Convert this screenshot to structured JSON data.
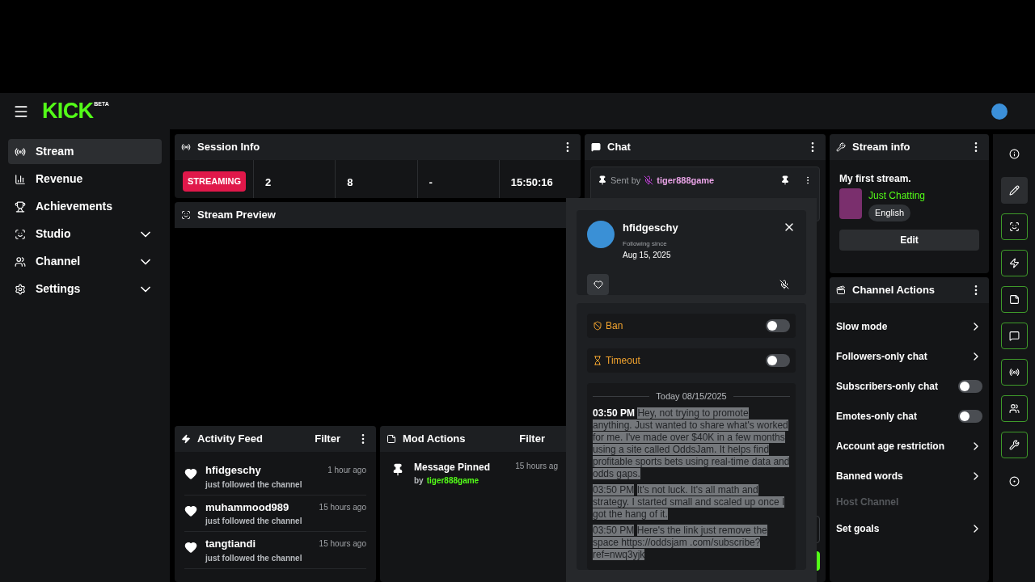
{
  "header": {
    "logo": "KICK",
    "logo_badge": "BETA"
  },
  "sidebar": {
    "items": [
      {
        "label": "Stream",
        "selected": true,
        "expandable": false
      },
      {
        "label": "Revenue",
        "selected": false,
        "expandable": false
      },
      {
        "label": "Achievements",
        "selected": false,
        "expandable": false
      },
      {
        "label": "Studio",
        "selected": false,
        "expandable": true
      },
      {
        "label": "Channel",
        "selected": false,
        "expandable": true
      },
      {
        "label": "Settings",
        "selected": false,
        "expandable": true
      }
    ]
  },
  "session_info": {
    "title": "Session Info",
    "status": "STREAMING",
    "stats": [
      "2",
      "8",
      "-",
      "15:50:16"
    ]
  },
  "stream_preview": {
    "title": "Stream Preview"
  },
  "activity_feed": {
    "title": "Activity Feed",
    "filter": "Filter",
    "events": [
      {
        "user": "hfidgeschy",
        "action": "just followed the channel",
        "time": "1 hour ago"
      },
      {
        "user": "muhammood989",
        "action": "just followed the channel",
        "time": "15 hours ago"
      },
      {
        "user": "tangtiandi",
        "action": "just followed the channel",
        "time": "15 hours ago"
      }
    ]
  },
  "mod_actions": {
    "title": "Mod Actions",
    "filter": "Filter",
    "events": [
      {
        "action": "Message Pinned",
        "by": "by",
        "user": "tiger888game",
        "time": "15 hours ag"
      }
    ]
  },
  "chat": {
    "title": "Chat",
    "pinned": {
      "sent_by": "Sent by",
      "user": "tiger888game"
    }
  },
  "user_card": {
    "username": "hfidgeschy",
    "following_label": "Following since",
    "following_date": "Aug 15, 2025",
    "moderation": [
      {
        "label": "Ban",
        "kind": "ban",
        "on": false
      },
      {
        "label": "Timeout",
        "kind": "timeout",
        "on": false
      }
    ],
    "date_divider": "Today 08/15/2025",
    "messages": [
      {
        "time": "03:50 PM",
        "text": "Hey, not trying to promote anything. Just wanted to share what's worked for me. I've made over $40K in a few months using a site called OddsJam. It helps find profitable sports bets using real-time data and odds gaps.",
        "highlighted": true,
        "time_highlighted": false
      },
      {
        "time": "03:50 PM",
        "text": "It's not luck. It's all math and strategy. I started small and scaled up once I got the hang of it.",
        "highlighted": true,
        "time_highlighted": true
      },
      {
        "time": "03:50 PM",
        "text": "Here's the link just remove the space https://oddsjam .com/subscribe?ref=nwq3yjk",
        "highlighted": true,
        "time_highlighted": true
      }
    ]
  },
  "stream_info": {
    "title": "Stream info",
    "stream_title": "My first stream.",
    "category": "Just Chatting",
    "language": "English",
    "edit": "Edit"
  },
  "channel_actions": {
    "title": "Channel Actions",
    "items": [
      {
        "label": "Slow mode",
        "kind": "link"
      },
      {
        "label": "Followers-only chat",
        "kind": "link"
      },
      {
        "label": "Subscribers-only chat",
        "kind": "toggle",
        "on": false
      },
      {
        "label": "Emotes-only chat",
        "kind": "toggle",
        "on": false
      },
      {
        "label": "Account age restriction",
        "kind": "link"
      },
      {
        "label": "Banned words",
        "kind": "link"
      },
      {
        "label": "Host Channel",
        "kind": "disabled"
      },
      {
        "label": "Set goals",
        "kind": "link"
      }
    ]
  },
  "rail": [
    {
      "kind": "plain"
    },
    {
      "kind": "active"
    },
    {
      "kind": "outlined"
    },
    {
      "kind": "outlined"
    },
    {
      "kind": "outlined"
    },
    {
      "kind": "outlined"
    },
    {
      "kind": "outlined"
    },
    {
      "kind": "outlined"
    },
    {
      "kind": "outlined"
    },
    {
      "kind": "plain"
    }
  ]
}
